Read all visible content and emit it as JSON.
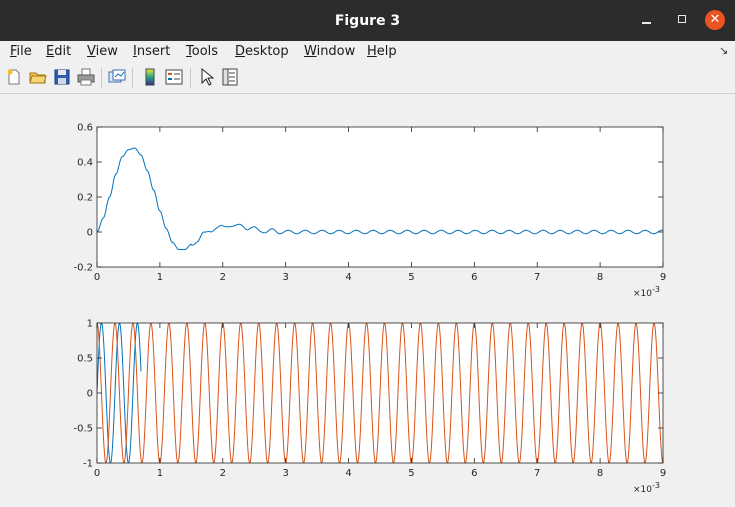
{
  "window": {
    "title": "Figure 3",
    "close_glyph": "✕"
  },
  "menu": [
    {
      "label": "File",
      "mnemonic": "F",
      "rest": "ile"
    },
    {
      "label": "Edit",
      "mnemonic": "E",
      "rest": "dit"
    },
    {
      "label": "View",
      "mnemonic": "V",
      "rest": "iew"
    },
    {
      "label": "Insert",
      "mnemonic": "I",
      "rest": "nsert"
    },
    {
      "label": "Tools",
      "mnemonic": "T",
      "rest": "ools"
    },
    {
      "label": "Desktop",
      "mnemonic": "D",
      "rest": "esktop"
    },
    {
      "label": "Window",
      "mnemonic": "W",
      "rest": "indow"
    },
    {
      "label": "Help",
      "mnemonic": "H",
      "rest": "elp"
    }
  ],
  "menu_dock_glyph": "↘",
  "toolbar": {
    "icons": [
      "new-figure-icon",
      "open-file-icon",
      "save-icon",
      "print-icon",
      "link-plot-icon",
      "insert-colorbar-icon",
      "insert-legend-icon",
      "edit-plot-icon",
      "property-inspector-icon"
    ]
  },
  "colors": {
    "series1": "#0072bd",
    "series2": "#d95319",
    "titlebar": "#2c2c2c",
    "close_button": "#e95420"
  },
  "chart_data": [
    {
      "type": "line",
      "xlim": [
        0,
        0.009
      ],
      "ylim": [
        -0.2,
        0.6
      ],
      "x_ticks": [
        0,
        1,
        2,
        3,
        4,
        5,
        6,
        7,
        8,
        9
      ],
      "x_tick_labels": [
        "0",
        "1",
        "2",
        "3",
        "4",
        "5",
        "6",
        "7",
        "8",
        "9"
      ],
      "y_ticks": [
        -0.2,
        0,
        0.2,
        0.4,
        0.6
      ],
      "y_tick_labels": [
        "-0.2",
        "0",
        "0.2",
        "0.4",
        "0.6"
      ],
      "x_exponent_label": "×10",
      "x_exponent_power": "-3",
      "grid": false,
      "series": [
        {
          "color": "#0072bd",
          "x": [
            0,
            0.0001,
            0.0002,
            0.0003,
            0.0004,
            0.0005,
            0.0006,
            0.0007,
            0.0008,
            0.0009,
            0.001,
            0.0011,
            0.0012,
            0.0013,
            0.0014,
            0.0015,
            0.0016,
            0.0017,
            0.0018,
            0.0019,
            0.002,
            0.0021,
            0.0022,
            0.0023,
            0.0024,
            0.0025,
            0.0026,
            0.0027,
            0.0028,
            0.0029,
            0.003,
            0.0035,
            0.004,
            0.005,
            0.006,
            0.007,
            0.008,
            0.009
          ],
          "y": [
            0,
            0.08,
            0.2,
            0.33,
            0.43,
            0.47,
            0.48,
            0.44,
            0.35,
            0.24,
            0.12,
            0.02,
            -0.06,
            -0.1,
            -0.1,
            -0.07,
            -0.05,
            -0.01,
            0.01,
            0.02,
            0.03,
            0.04,
            0.03,
            0.04,
            0.02,
            0.02,
            0.01,
            0.0,
            0.01,
            0.0,
            0.0,
            0.0,
            0.0,
            0.0,
            0.0,
            0.0,
            0.0,
            0.0
          ],
          "ripple_amplitude": 0.01,
          "ripple_cycles_per_ms": 3.7
        }
      ]
    },
    {
      "type": "line",
      "xlim": [
        0,
        0.009
      ],
      "ylim": [
        -1,
        1
      ],
      "x_ticks": [
        0,
        1,
        2,
        3,
        4,
        5,
        6,
        7,
        8,
        9
      ],
      "x_tick_labels": [
        "0",
        "1",
        "2",
        "3",
        "4",
        "5",
        "6",
        "7",
        "8",
        "9"
      ],
      "y_ticks": [
        -1,
        -0.5,
        0,
        0.5,
        1
      ],
      "y_tick_labels": [
        "-1",
        "-0.5",
        "0",
        "0.5",
        "1"
      ],
      "x_exponent_label": "×10",
      "x_exponent_power": "-3",
      "grid": false,
      "series": [
        {
          "color": "#0072bd",
          "function": "sin",
          "frequency_cycles_per_ms": 3.5,
          "amplitude": 1,
          "x_range": [
            0,
            0.0007
          ]
        },
        {
          "color": "#d95319",
          "function": "cos",
          "frequency_cycles_per_ms": 3.5,
          "amplitude": 1,
          "x_range": [
            0,
            0.009
          ]
        }
      ]
    }
  ]
}
